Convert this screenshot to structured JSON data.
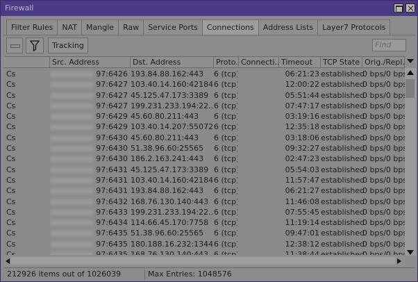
{
  "window": {
    "title": "Firewall"
  },
  "tabs": [
    "Filter Rules",
    "NAT",
    "Mangle",
    "Raw",
    "Service Ports",
    "Connections",
    "Address Lists",
    "Layer7 Protocols"
  ],
  "active_tab": "Connections",
  "toolbar": {
    "tracking_label": "Tracking",
    "find_placeholder": "Find"
  },
  "columns": [
    "",
    "Src. Address",
    "Dst. Address",
    "Proto...",
    "Connecti...",
    "Timeout",
    "TCP State",
    "Orig./Repl. R"
  ],
  "rows": [
    {
      "flag": "Cs",
      "src_port": "97:6426",
      "dst": "193.84.88.162:443",
      "proto": "6 (tcp)",
      "conn": "",
      "timeout": "06:21:23",
      "tcp": "established",
      "rate": "0 bps/0 bps"
    },
    {
      "flag": "Cs",
      "src_port": "97:6427",
      "dst": "103.40.14.160:42184",
      "proto": "6 (tcp)",
      "conn": "",
      "timeout": "12:00:22",
      "tcp": "established",
      "rate": "0 bps/0 bps"
    },
    {
      "flag": "Cs",
      "src_port": "97:6427",
      "dst": "45.125.47.173:3389",
      "proto": "6 (tcp)",
      "conn": "",
      "timeout": "05:51:44",
      "tcp": "established",
      "rate": "0 bps/0 bps"
    },
    {
      "flag": "Cs",
      "src_port": "97:6427",
      "dst": "199.231.233.194:22...",
      "proto": "6 (tcp)",
      "conn": "",
      "timeout": "07:47:17",
      "tcp": "established",
      "rate": "0 bps/0 bps"
    },
    {
      "flag": "Cs",
      "src_port": "97:6429",
      "dst": "45.60.80.211:443",
      "proto": "6 (tcp)",
      "conn": "",
      "timeout": "03:19:16",
      "tcp": "established",
      "rate": "0 bps/0 bps"
    },
    {
      "flag": "Cs",
      "src_port": "97:6429",
      "dst": "103.40.14.207:55072",
      "proto": "6 (tcp)",
      "conn": "",
      "timeout": "12:35:18",
      "tcp": "established",
      "rate": "0 bps/0 bps"
    },
    {
      "flag": "Cs",
      "src_port": "97:6430",
      "dst": "45.60.80.211:443",
      "proto": "6 (tcp)",
      "conn": "",
      "timeout": "03:18:06",
      "tcp": "established",
      "rate": "0 bps/0 bps"
    },
    {
      "flag": "Cs",
      "src_port": "97:6430",
      "dst": "51.38.96.60:25565",
      "proto": "6 (tcp)",
      "conn": "",
      "timeout": "09:32:27",
      "tcp": "established",
      "rate": "0 bps/0 bps"
    },
    {
      "flag": "Cs",
      "src_port": "97:6430",
      "dst": "186.2.163.241:443",
      "proto": "6 (tcp)",
      "conn": "",
      "timeout": "02:47:23",
      "tcp": "established",
      "rate": "0 bps/0 bps"
    },
    {
      "flag": "Cs",
      "src_port": "97:6431",
      "dst": "45.125.47.173:3389",
      "proto": "6 (tcp)",
      "conn": "",
      "timeout": "05:54:03",
      "tcp": "established",
      "rate": "0 bps/0 bps"
    },
    {
      "flag": "Cs",
      "src_port": "97:6431",
      "dst": "103.40.14.160:42184",
      "proto": "6 (tcp)",
      "conn": "",
      "timeout": "11:57:47",
      "tcp": "established",
      "rate": "0 bps/0 bps"
    },
    {
      "flag": "Cs",
      "src_port": "97:6431",
      "dst": "193.84.88.162:443",
      "proto": "6 (tcp)",
      "conn": "",
      "timeout": "06:21:27",
      "tcp": "established",
      "rate": "0 bps/0 bps"
    },
    {
      "flag": "Cs",
      "src_port": "97:6432",
      "dst": "168.76.130.140:443",
      "proto": "6 (tcp)",
      "conn": "",
      "timeout": "11:46:08",
      "tcp": "established",
      "rate": "0 bps/0 bps"
    },
    {
      "flag": "Cs",
      "src_port": "97:6433",
      "dst": "199.231.233.194:22...",
      "proto": "6 (tcp)",
      "conn": "",
      "timeout": "07:55:45",
      "tcp": "established",
      "rate": "0 bps/0 bps"
    },
    {
      "flag": "Cs",
      "src_port": "97:6434",
      "dst": "114.66.45.170:7758",
      "proto": "6 (tcp)",
      "conn": "",
      "timeout": "11:19:14",
      "tcp": "established",
      "rate": "0 bps/0 bps"
    },
    {
      "flag": "Cs",
      "src_port": "97:6435",
      "dst": "51.38.96.60:25565",
      "proto": "6 (tcp)",
      "conn": "",
      "timeout": "09:47:01",
      "tcp": "established",
      "rate": "0 bps/0 bps"
    },
    {
      "flag": "Cs",
      "src_port": "97:6435",
      "dst": "180.188.16.232:13448",
      "proto": "6 (tcp)",
      "conn": "",
      "timeout": "12:38:12",
      "tcp": "established",
      "rate": "0 bps/0 bps"
    },
    {
      "flag": "Cs",
      "src_port": "97:6435",
      "dst": "168.76.130.140:443",
      "proto": "6 (tcp)",
      "conn": "",
      "timeout": "11:38:44",
      "tcp": "established",
      "rate": "0 bps/0 bps"
    }
  ],
  "status": {
    "items_label": "212926 items out of 1026039",
    "max_entries_label": "Max Entries: 1048576"
  }
}
